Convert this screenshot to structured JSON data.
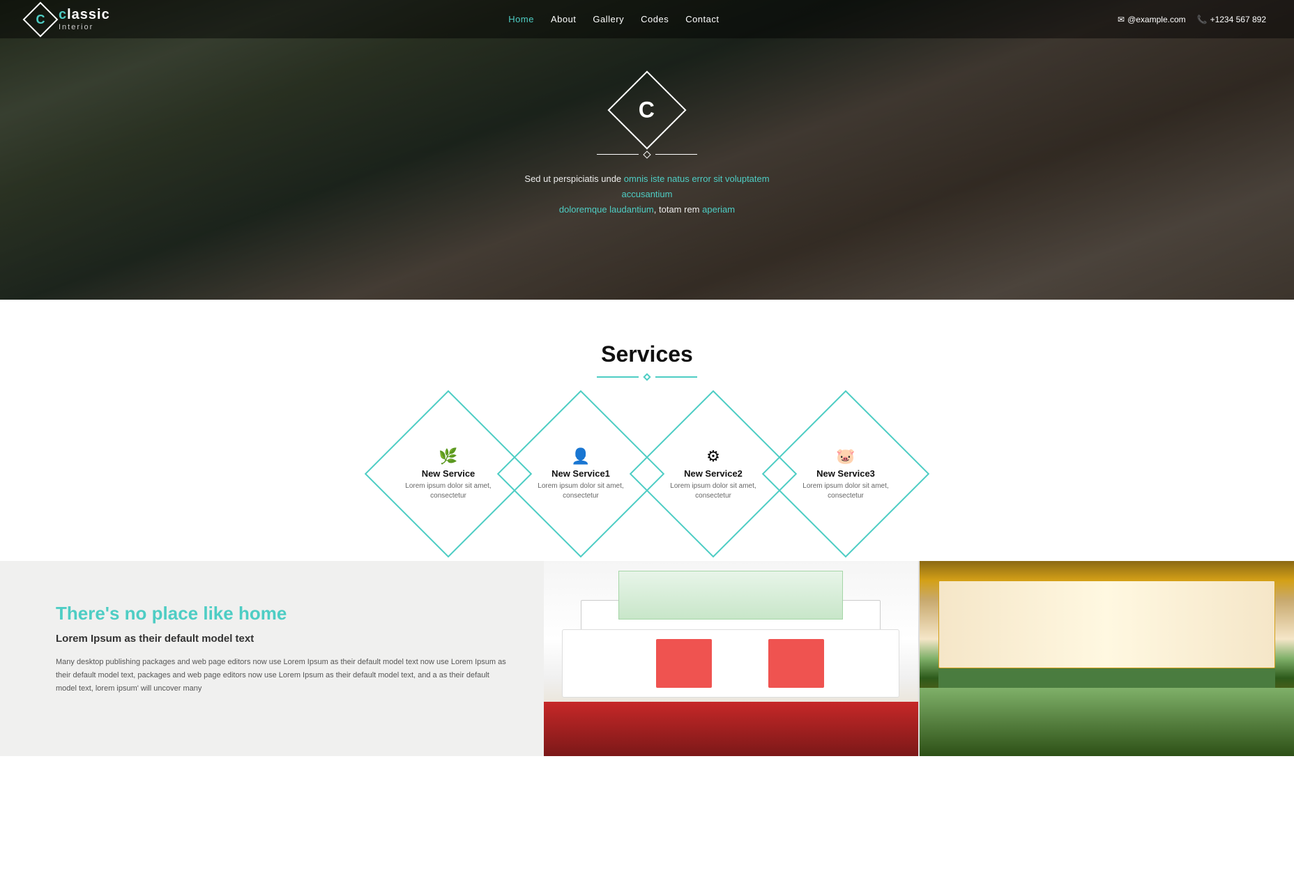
{
  "site": {
    "logo_letter": "c",
    "logo_name": "lassic",
    "logo_tagline": "Interior"
  },
  "navbar": {
    "links": [
      {
        "label": "Home",
        "active": true
      },
      {
        "label": "About"
      },
      {
        "label": "Gallery"
      },
      {
        "label": "Codes"
      },
      {
        "label": "Contact"
      }
    ],
    "email": "@example.com",
    "phone": "+1234 567 892"
  },
  "hero": {
    "logo_letter": "C",
    "body_text": "Sed ut perspiciatis unde omnis iste natus error sit voluptatem accusantium doloremque laudantium, totam rem aperiam"
  },
  "services": {
    "title": "Services",
    "items": [
      {
        "name": "New Service",
        "desc": "Lorem ipsum dolor sit amet, consectetur",
        "icon": "🌿"
      },
      {
        "name": "New Service1",
        "desc": "Lorem ipsum dolor sit amet, consectetur",
        "icon": "👤"
      },
      {
        "name": "New Service2",
        "desc": "Lorem ipsum dolor sit amet, consectetur",
        "icon": "⚙"
      },
      {
        "name": "New Service3",
        "desc": "Lorem ipsum dolor sit amet, consectetur",
        "icon": "🐷"
      }
    ]
  },
  "about": {
    "title": "There's no place like home",
    "subtitle": "Lorem Ipsum as their default model text",
    "body": "Many desktop publishing packages and web page editors now use Lorem Ipsum as their default model text now use Lorem Ipsum as their default model text, packages and web page editors now use Lorem Ipsum as their default model text, and a as their default model text, lorem ipsum' will uncover many"
  },
  "colors": {
    "teal": "#4ecdc4",
    "dark": "#111111",
    "light_bg": "#f0f0ef"
  }
}
